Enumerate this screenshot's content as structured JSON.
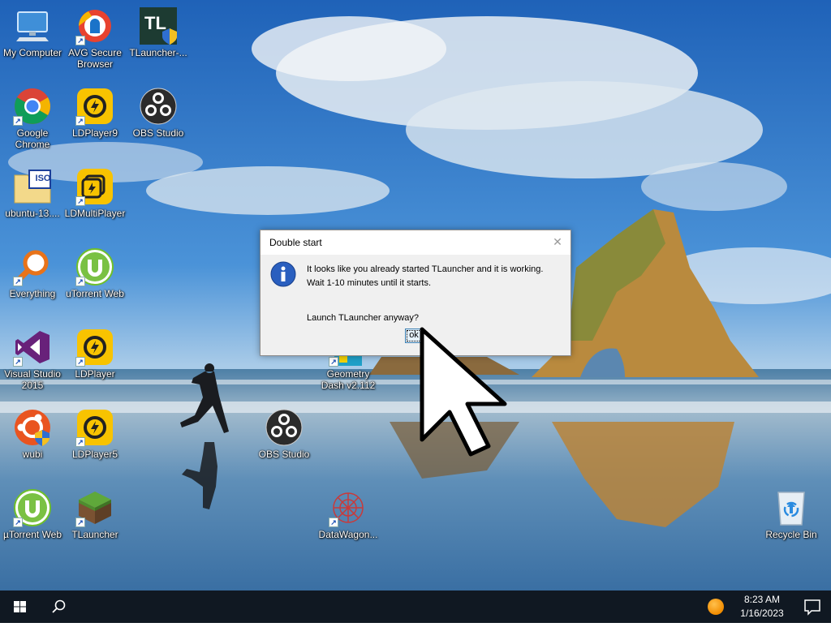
{
  "desktop": {
    "icons": [
      {
        "label": "My Computer"
      },
      {
        "label": "AVG Secure Browser"
      },
      {
        "label": "TLauncher-..."
      },
      {
        "label": "Google Chrome"
      },
      {
        "label": "LDPlayer9"
      },
      {
        "label": "OBS Studio"
      },
      {
        "label": "ubuntu-13...."
      },
      {
        "label": "LDMultiPlayer"
      },
      {
        "label": "Everything"
      },
      {
        "label": "uTorrent Web"
      },
      {
        "label": "Visual Studio 2015"
      },
      {
        "label": "LDPlayer"
      },
      {
        "label": "Geometry Dash v2.112"
      },
      {
        "label": "wubi"
      },
      {
        "label": "LDPlayer5"
      },
      {
        "label": "OBS Studio"
      },
      {
        "label": "µTorrent Web"
      },
      {
        "label": "TLauncher"
      },
      {
        "label": "DataWagon..."
      },
      {
        "label": "Recycle Bin"
      }
    ],
    "tlauncher_icon_text": "TL",
    "iso_badge_text": "ISO"
  },
  "dialog": {
    "title": "Double start",
    "close_glyph": "✕",
    "message_line1": "It looks like you already started TLauncher and it is working.",
    "message_line2": "Wait 1-10 minutes until it starts.",
    "message_line3": "Launch TLauncher anyway?",
    "ok_label": "ok"
  },
  "taskbar": {
    "time": "8:23 AM",
    "date": "1/16/2023"
  },
  "colors": {
    "taskbar_bg": "#101822",
    "dialog_bg": "#f0f0f0",
    "info_icon_blue": "#2a5fbf"
  }
}
